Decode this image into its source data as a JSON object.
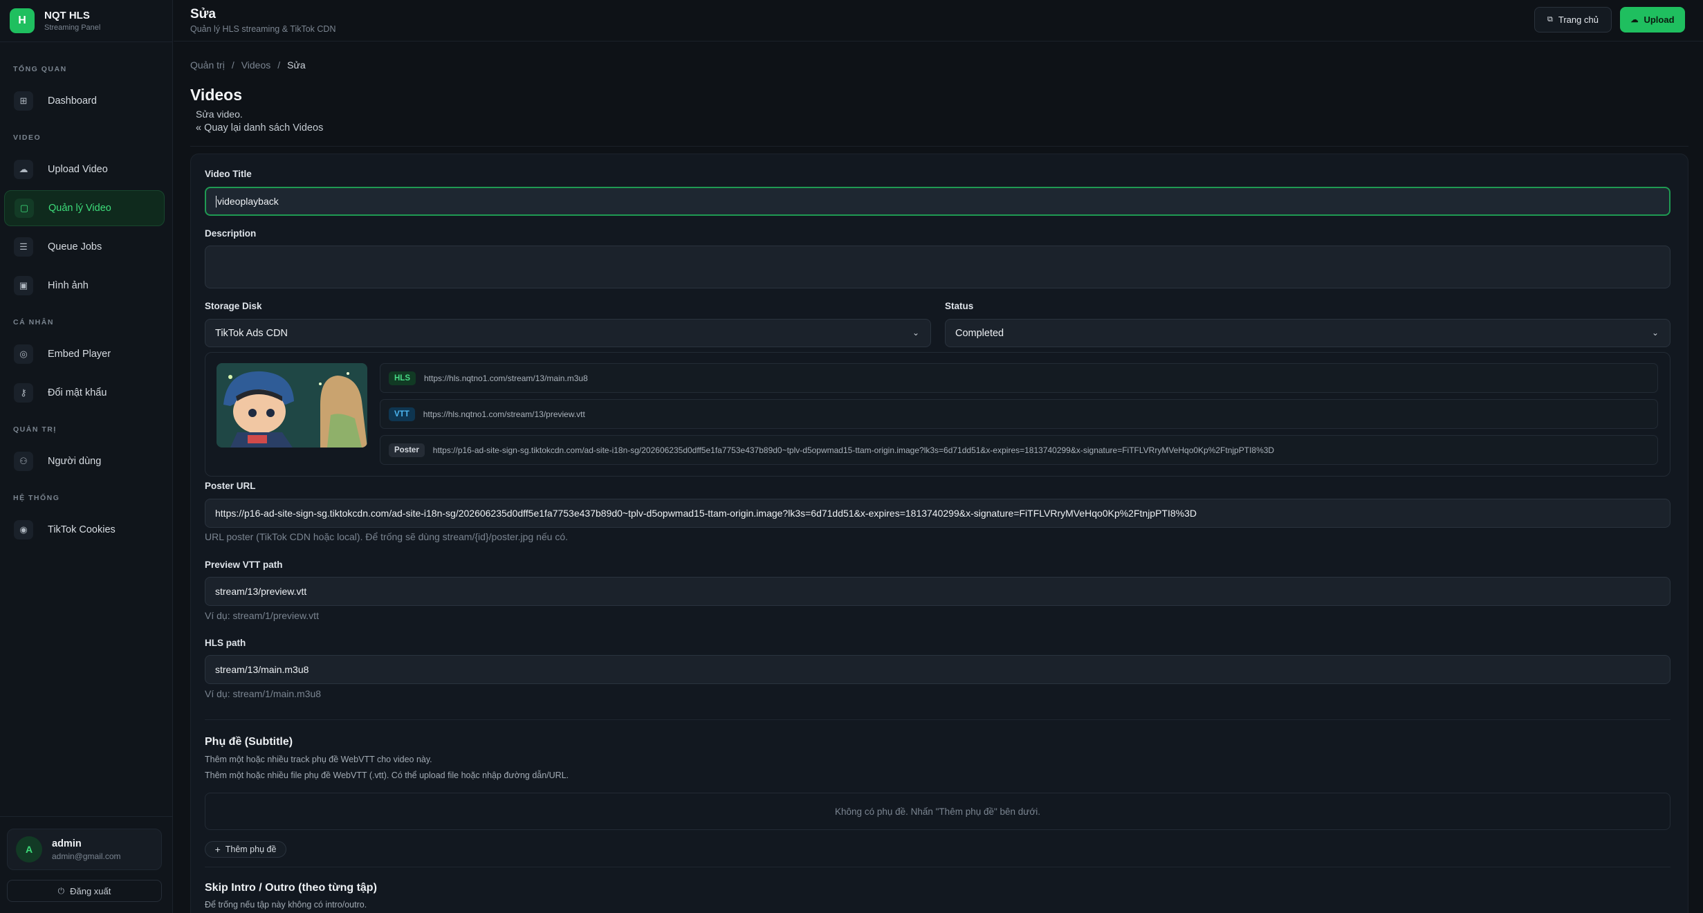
{
  "app": {
    "name": "NQT HLS",
    "subtitle": "Streaming Panel",
    "logo_letter": "H"
  },
  "sidebar": {
    "sections": [
      {
        "label": "TỔNG QUAN",
        "items": [
          {
            "label": "Dashboard",
            "icon": "grid-icon"
          }
        ]
      },
      {
        "label": "VIDEO",
        "items": [
          {
            "label": "Upload Video",
            "icon": "cloud-upload-icon"
          },
          {
            "label": "Quản lý Video",
            "icon": "video-square-icon",
            "active": true
          },
          {
            "label": "Queue Jobs",
            "icon": "list-icon"
          },
          {
            "label": "Hình ảnh",
            "icon": "image-icon"
          }
        ]
      },
      {
        "label": "CÁ NHÂN",
        "items": [
          {
            "label": "Embed Player",
            "icon": "target-icon"
          },
          {
            "label": "Đổi mật khẩu",
            "icon": "key-icon"
          }
        ]
      },
      {
        "label": "QUẢN TRỊ",
        "items": [
          {
            "label": "Người dùng",
            "icon": "users-icon"
          }
        ]
      },
      {
        "label": "HỆ THỐNG",
        "items": [
          {
            "label": "TikTok Cookies",
            "icon": "cookie-icon"
          }
        ]
      }
    ],
    "user": {
      "avatar_letter": "A",
      "name": "admin",
      "email": "admin@gmail.com"
    },
    "logout_label": "Đăng xuất"
  },
  "topbar": {
    "title": "Sửa",
    "subtitle": "Quản lý HLS streaming & TikTok CDN",
    "home_label": "Trang chủ",
    "upload_label": "Upload"
  },
  "breadcrumb": {
    "items": [
      "Quản trị",
      "Videos",
      "Sửa"
    ],
    "separator": "/"
  },
  "page": {
    "title": "Videos",
    "subtitle": "Sửa video.",
    "back_link": "Quay lại danh sách Videos"
  },
  "form": {
    "title_label": "Video Title",
    "title_value": "videoplayback",
    "description_label": "Description",
    "description_value": "",
    "storage_label": "Storage Disk",
    "storage_value": "TikTok Ads CDN",
    "status_label": "Status",
    "status_value": "Completed",
    "media": {
      "hls_tag": "HLS",
      "hls_url": "https://hls.nqtno1.com/stream/13/main.m3u8",
      "vtt_tag": "VTT",
      "vtt_url": "https://hls.nqtno1.com/stream/13/preview.vtt",
      "poster_tag": "Poster",
      "poster_url": "https://p16-ad-site-sign-sg.tiktokcdn.com/ad-site-i18n-sg/202606235d0dff5e1fa7753e437b89d0~tplv-d5opwmad15-ttam-origin.image?lk3s=6d71dd51&x-expires=1813740299&x-signature=FiTFLVRryMVeHqo0Kp%2FtnjpPTI8%3D"
    },
    "poster_label": "Poster URL",
    "poster_value": "https://p16-ad-site-sign-sg.tiktokcdn.com/ad-site-i18n-sg/202606235d0dff5e1fa7753e437b89d0~tplv-d5opwmad15-ttam-origin.image?lk3s=6d71dd51&x-expires=1813740299&x-signature=FiTFLVRryMVeHqo0Kp%2FtnjpPTI8%3D",
    "poster_help": "URL poster (TikTok CDN hoặc local). Để trống sẽ dùng stream/{id}/poster.jpg nếu có.",
    "vtt_label": "Preview VTT path",
    "vtt_value": "stream/13/preview.vtt",
    "vtt_help": "Ví dụ: stream/1/preview.vtt",
    "hls_label": "HLS path",
    "hls_value": "stream/13/main.m3u8",
    "hls_help": "Ví dụ: stream/1/main.m3u8"
  },
  "subtitles": {
    "title": "Phụ đề (Subtitle)",
    "desc1": "Thêm một hoặc nhiều track phụ đề WebVTT cho video này.",
    "desc2": "Thêm một hoặc nhiều file phụ đề WebVTT (.vtt). Có thể upload file hoặc nhập đường dẫn/URL.",
    "empty": "Không có phụ đề. Nhấn \"Thêm phụ đề\" bên dưới.",
    "add_label": "Thêm phụ đề"
  },
  "skip": {
    "title": "Skip Intro / Outro (theo từng tập)",
    "desc": "Để trống nếu tập này không có intro/outro."
  },
  "colors": {
    "accent": "#1fbf5f",
    "bg": "#0e1217",
    "panel": "#121820"
  }
}
